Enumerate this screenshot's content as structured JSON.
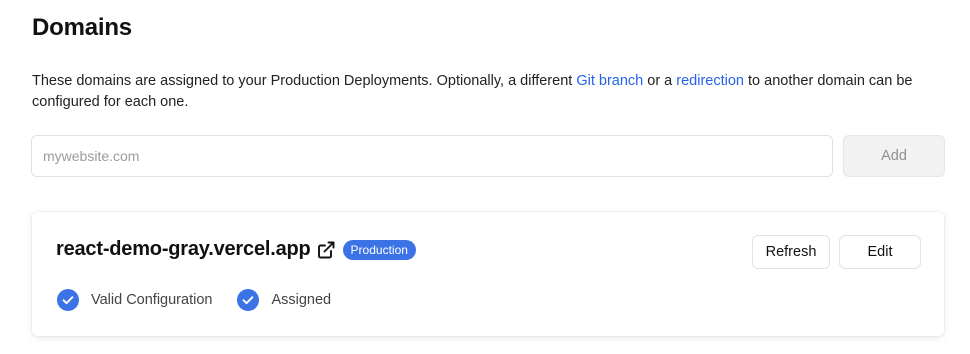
{
  "section": {
    "title": "Domains",
    "description": {
      "before": "These domains are assigned to your Production Deployments. Optionally, a different ",
      "link_git_branch": "Git branch",
      "middle": " or a ",
      "link_redirection": "redirection",
      "after": " to another domain can be configured for each one."
    }
  },
  "add_form": {
    "placeholder": "mywebsite.com",
    "value": "",
    "add_label": "Add"
  },
  "domain_card": {
    "domain": "react-demo-gray.vercel.app",
    "badge": "Production",
    "refresh_label": "Refresh",
    "edit_label": "Edit",
    "statuses": [
      {
        "label": "Valid Configuration",
        "icon": "check-circle-icon"
      },
      {
        "label": "Assigned",
        "icon": "check-circle-icon"
      }
    ]
  },
  "colors": {
    "accent_link": "#2563eb",
    "badge_bg": "#3b73e6",
    "check_bg": "#3b73e6"
  }
}
